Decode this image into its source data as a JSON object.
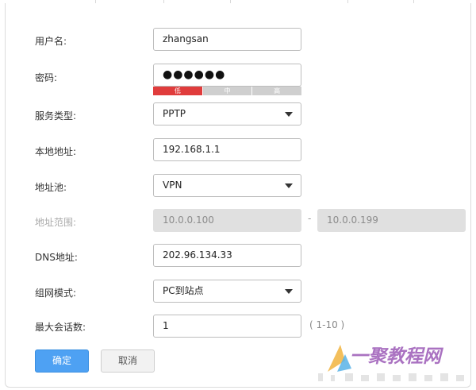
{
  "form": {
    "username": {
      "label": "用户名:",
      "value": "zhangsan"
    },
    "password": {
      "label": "密码:",
      "value": "●●●●●●",
      "strength_labels": [
        "低",
        "中",
        "高"
      ],
      "strength_level": "低"
    },
    "service_type": {
      "label": "服务类型:",
      "value": "PPTP"
    },
    "local_address": {
      "label": "本地地址:",
      "value": "192.168.1.1"
    },
    "address_pool": {
      "label": "地址池:",
      "value": "VPN"
    },
    "address_range": {
      "label": "地址范围:",
      "start": "10.0.0.100",
      "separator": "-",
      "end": "10.0.0.199"
    },
    "dns": {
      "label": "DNS地址:",
      "value": "202.96.134.33"
    },
    "network_mode": {
      "label": "组网模式:",
      "value": "PC到站点"
    },
    "max_sessions": {
      "label": "最大会话数:",
      "value": "1",
      "hint": "( 1-10 )"
    }
  },
  "buttons": {
    "ok": "确定",
    "cancel": "取消"
  },
  "watermark": {
    "text": "一聚教程网"
  },
  "colors": {
    "accent": "#4ea1f3",
    "strength_weak": "#e03c3c",
    "watermark": "#9b59b6"
  }
}
